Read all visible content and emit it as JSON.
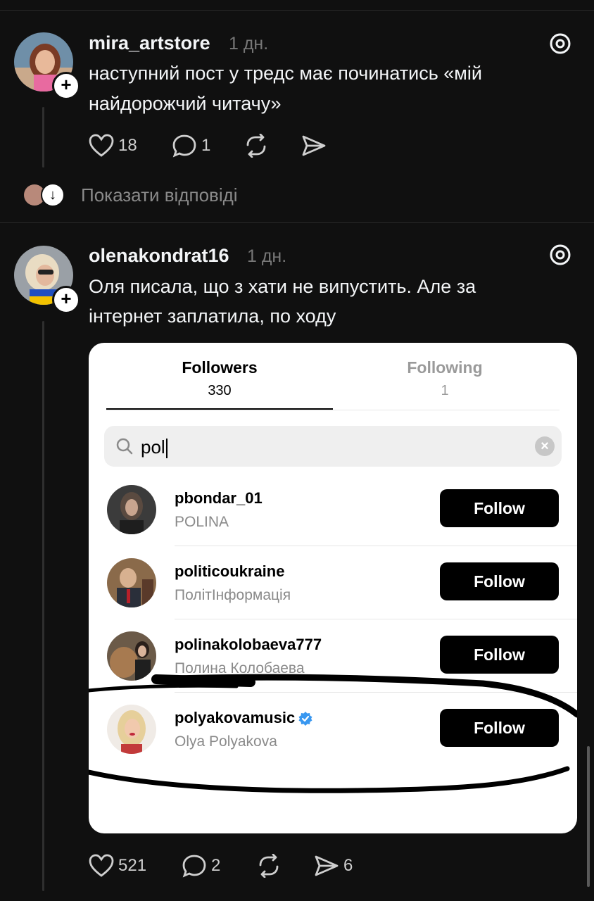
{
  "post1": {
    "username": "mira_artstore",
    "time": "1 дн.",
    "text_line1": "наступний пост у тредс має починатись «мій",
    "text_line2": "найдорожчий читачу»",
    "likes": "18",
    "comments": "1",
    "show_replies": "Показати відповіді"
  },
  "post2": {
    "username": "olenakondrat16",
    "time": "1 дн.",
    "text_line1": "Оля писала, що з хати не випустить. Але за",
    "text_line2": "інтернет заплатила, по ходу",
    "likes": "521",
    "comments": "2",
    "shares": "6"
  },
  "embedded": {
    "tabs": [
      {
        "label": "Followers",
        "count": "330"
      },
      {
        "label": "Following",
        "count": "1"
      }
    ],
    "search_value": "pol",
    "rows": [
      {
        "username": "pbondar_01",
        "name": "POLINA",
        "button": "Follow"
      },
      {
        "username": "politicoukraine",
        "name": "ПолітІнформація",
        "button": "Follow"
      },
      {
        "username": "polinakolobaeva777",
        "name": "Полина Колобаева",
        "button": "Follow"
      },
      {
        "username": "polyakovamusic",
        "name": "Olya Polyakova",
        "button": "Follow"
      }
    ]
  },
  "colors": {
    "background": "#101010",
    "card": "#ffffff",
    "button": "#000000",
    "verified": "#3897f0",
    "annotation": "#000000"
  }
}
